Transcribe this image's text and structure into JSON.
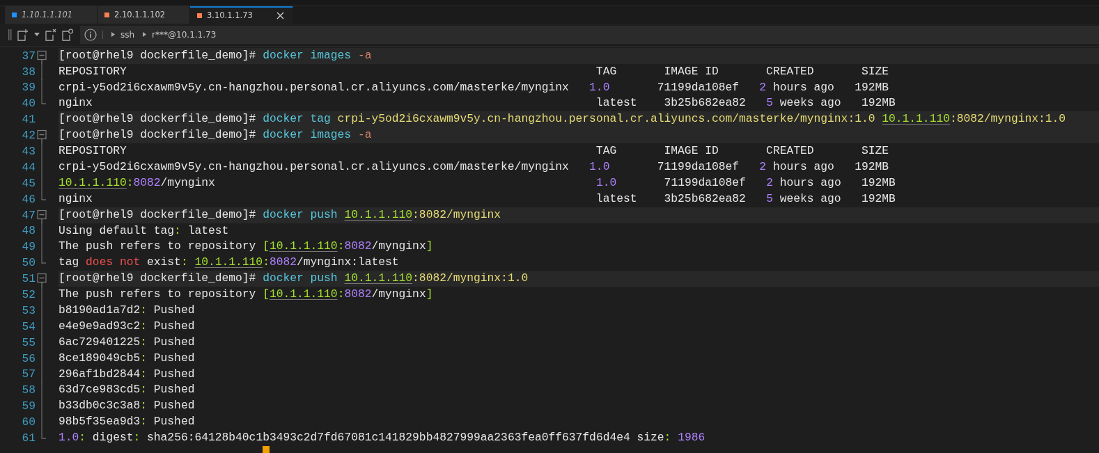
{
  "tabs": [
    {
      "label": "1.10.1.1.101",
      "selected": false,
      "connected": false,
      "color": "#1e90ff"
    },
    {
      "label": "2.10.1.1.102",
      "selected": false,
      "connected": true,
      "color": "#ff7f50"
    },
    {
      "label": "3.10.1.1.73",
      "selected": true,
      "connected": true,
      "color": "#ff7f50"
    }
  ],
  "breadcrumb": [
    "ssh",
    "r***@10.1.1.73"
  ],
  "commands": [
    {
      "no": "37",
      "segs": [
        {
          "t": "[root@rhel9 dockerfile_demo]# ",
          "kind": "plain"
        },
        {
          "t": "docker images",
          "kind": "cmd"
        },
        {
          "t": " -a",
          "kind": "flag"
        }
      ],
      "children": [
        {
          "no": "38",
          "segs": [
            {
              "t": "REPOSITORY                                                                     TAG       IMAGE ID       CREATED       SIZE",
              "kind": "plain"
            }
          ]
        },
        {
          "no": "39",
          "segs": [
            {
              "t": "crpi-y5od2i6cxawm9v5y.cn-hangzhou.personal.cr.aliyuncs.com/masterke/mynginx   ",
              "kind": "plain"
            },
            {
              "t": "1.0",
              "kind": "num"
            },
            {
              "t": "       71199da108ef   ",
              "kind": "plain"
            },
            {
              "t": "2",
              "kind": "num"
            },
            {
              "t": " hours ago   192MB",
              "kind": "plain"
            }
          ]
        },
        {
          "no": "40",
          "segs": [
            {
              "t": "nginx                                                                          latest    3b25b682ea82   ",
              "kind": "plain"
            },
            {
              "t": "5",
              "kind": "num"
            },
            {
              "t": " weeks ago   192MB",
              "kind": "plain"
            }
          ]
        }
      ]
    },
    {
      "no": "41",
      "segs": [
        {
          "t": "[root@rhel9 dockerfile_demo]# ",
          "kind": "plain"
        },
        {
          "t": "docker tag",
          "kind": "cmd"
        },
        {
          "t": " crpi-y5od2i6cxawm9v5y.cn-hangzhou.personal.cr.aliyuncs.com/masterke/mynginx:1.0 ",
          "kind": "str"
        },
        {
          "t": "10.1.1.110",
          "kind": "ip"
        },
        {
          "t": ":8082/mynginx:1.0",
          "kind": "str"
        }
      ]
    },
    {
      "no": "42",
      "segs": [
        {
          "t": "[root@rhel9 dockerfile_demo]# ",
          "kind": "plain"
        },
        {
          "t": "docker images",
          "kind": "cmd"
        },
        {
          "t": " -a",
          "kind": "flag"
        }
      ],
      "children": [
        {
          "no": "43",
          "segs": [
            {
              "t": "REPOSITORY                                                                     TAG       IMAGE ID       CREATED       SIZE",
              "kind": "plain"
            }
          ]
        },
        {
          "no": "44",
          "segs": [
            {
              "t": "crpi-y5od2i6cxawm9v5y.cn-hangzhou.personal.cr.aliyuncs.com/masterke/mynginx   ",
              "kind": "plain"
            },
            {
              "t": "1.0",
              "kind": "num"
            },
            {
              "t": "       71199da108ef   ",
              "kind": "plain"
            },
            {
              "t": "2",
              "kind": "num"
            },
            {
              "t": " hours ago   192MB",
              "kind": "plain"
            }
          ]
        },
        {
          "no": "45",
          "segs": [
            {
              "t": "10.1.1.110",
              "kind": "ip"
            },
            {
              "t": ":",
              "kind": "punct"
            },
            {
              "t": "8082",
              "kind": "num"
            },
            {
              "t": "/mynginx                                                        ",
              "kind": "plain"
            },
            {
              "t": "1.0",
              "kind": "num"
            },
            {
              "t": "       71199da108ef   ",
              "kind": "plain"
            },
            {
              "t": "2",
              "kind": "num"
            },
            {
              "t": " hours ago   192MB",
              "kind": "plain"
            }
          ]
        },
        {
          "no": "46",
          "segs": [
            {
              "t": "nginx                                                                          latest    3b25b682ea82   ",
              "kind": "plain"
            },
            {
              "t": "5",
              "kind": "num"
            },
            {
              "t": " weeks ago   192MB",
              "kind": "plain"
            }
          ]
        }
      ]
    },
    {
      "no": "47",
      "segs": [
        {
          "t": "[root@rhel9 dockerfile_demo]# ",
          "kind": "plain"
        },
        {
          "t": "docker push ",
          "kind": "cmd"
        },
        {
          "t": "10.1.1.110",
          "kind": "ip"
        },
        {
          "t": ":8082/mynginx",
          "kind": "str"
        }
      ],
      "children": [
        {
          "no": "48",
          "segs": [
            {
              "t": "Using default tag",
              "kind": "plain"
            },
            {
              "t": ":",
              "kind": "punct"
            },
            {
              "t": " latest",
              "kind": "plain"
            }
          ]
        },
        {
          "no": "49",
          "segs": [
            {
              "t": "The push refers to repository ",
              "kind": "plain"
            },
            {
              "t": "[",
              "kind": "punct"
            },
            {
              "t": "10.1.1.110",
              "kind": "ip"
            },
            {
              "t": ":",
              "kind": "punct"
            },
            {
              "t": "8082",
              "kind": "num"
            },
            {
              "t": "/mynginx",
              "kind": "plain"
            },
            {
              "t": "]",
              "kind": "punct"
            }
          ]
        },
        {
          "no": "50",
          "segs": [
            {
              "t": "tag ",
              "kind": "plain"
            },
            {
              "t": "does not",
              "kind": "err"
            },
            {
              "t": " exist",
              "kind": "plain"
            },
            {
              "t": ": ",
              "kind": "punct"
            },
            {
              "t": "10.1.1.110",
              "kind": "ip"
            },
            {
              "t": ":",
              "kind": "punct"
            },
            {
              "t": "8082",
              "kind": "num"
            },
            {
              "t": "/mynginx:latest",
              "kind": "plain"
            }
          ]
        }
      ]
    },
    {
      "no": "51",
      "segs": [
        {
          "t": "[root@rhel9 dockerfile_demo]# ",
          "kind": "plain"
        },
        {
          "t": "docker push ",
          "kind": "cmd"
        },
        {
          "t": "10.1.1.110",
          "kind": "ip"
        },
        {
          "t": ":8082/mynginx:1.0",
          "kind": "str"
        }
      ],
      "children": [
        {
          "no": "52",
          "segs": [
            {
              "t": "The push refers to repository ",
              "kind": "plain"
            },
            {
              "t": "[",
              "kind": "punct"
            },
            {
              "t": "10.1.1.110",
              "kind": "ip"
            },
            {
              "t": ":",
              "kind": "punct"
            },
            {
              "t": "8082",
              "kind": "num"
            },
            {
              "t": "/mynginx",
              "kind": "plain"
            },
            {
              "t": "]",
              "kind": "punct"
            }
          ]
        },
        {
          "no": "53",
          "segs": [
            {
              "t": "b8190ad1a7d2",
              "kind": "plain"
            },
            {
              "t": ":",
              "kind": "punct"
            },
            {
              "t": " Pushed",
              "kind": "plain"
            }
          ]
        },
        {
          "no": "54",
          "segs": [
            {
              "t": "e4e9e9ad93c2",
              "kind": "plain"
            },
            {
              "t": ":",
              "kind": "punct"
            },
            {
              "t": " Pushed",
              "kind": "plain"
            }
          ]
        },
        {
          "no": "55",
          "segs": [
            {
              "t": "6ac729401225",
              "kind": "plain"
            },
            {
              "t": ":",
              "kind": "punct"
            },
            {
              "t": " Pushed",
              "kind": "plain"
            }
          ]
        },
        {
          "no": "56",
          "segs": [
            {
              "t": "8ce189049cb5",
              "kind": "plain"
            },
            {
              "t": ":",
              "kind": "punct"
            },
            {
              "t": " Pushed",
              "kind": "plain"
            }
          ]
        },
        {
          "no": "57",
          "segs": [
            {
              "t": "296af1bd2844",
              "kind": "plain"
            },
            {
              "t": ":",
              "kind": "punct"
            },
            {
              "t": " Pushed",
              "kind": "plain"
            }
          ]
        },
        {
          "no": "58",
          "segs": [
            {
              "t": "63d7ce983cd5",
              "kind": "plain"
            },
            {
              "t": ":",
              "kind": "punct"
            },
            {
              "t": " Pushed",
              "kind": "plain"
            }
          ]
        },
        {
          "no": "59",
          "segs": [
            {
              "t": "b33db0c3c3a8",
              "kind": "plain"
            },
            {
              "t": ":",
              "kind": "punct"
            },
            {
              "t": " Pushed",
              "kind": "plain"
            }
          ]
        },
        {
          "no": "60",
          "segs": [
            {
              "t": "98b5f35ea9d3",
              "kind": "plain"
            },
            {
              "t": ":",
              "kind": "punct"
            },
            {
              "t": " Pushed",
              "kind": "plain"
            }
          ]
        },
        {
          "no": "61",
          "segs": [
            {
              "t": "1.0",
              "kind": "num"
            },
            {
              "t": ":",
              "kind": "punct"
            },
            {
              "t": " digest",
              "kind": "plain"
            },
            {
              "t": ":",
              "kind": "punct"
            },
            {
              "t": " sha256:64128b40c1b3493c2d7fd67081c141829bb4827999aa2363fea0ff637fd6d4e4 size",
              "kind": "plain"
            },
            {
              "t": ": ",
              "kind": "punct"
            },
            {
              "t": "1986",
              "kind": "num"
            }
          ]
        }
      ]
    }
  ]
}
